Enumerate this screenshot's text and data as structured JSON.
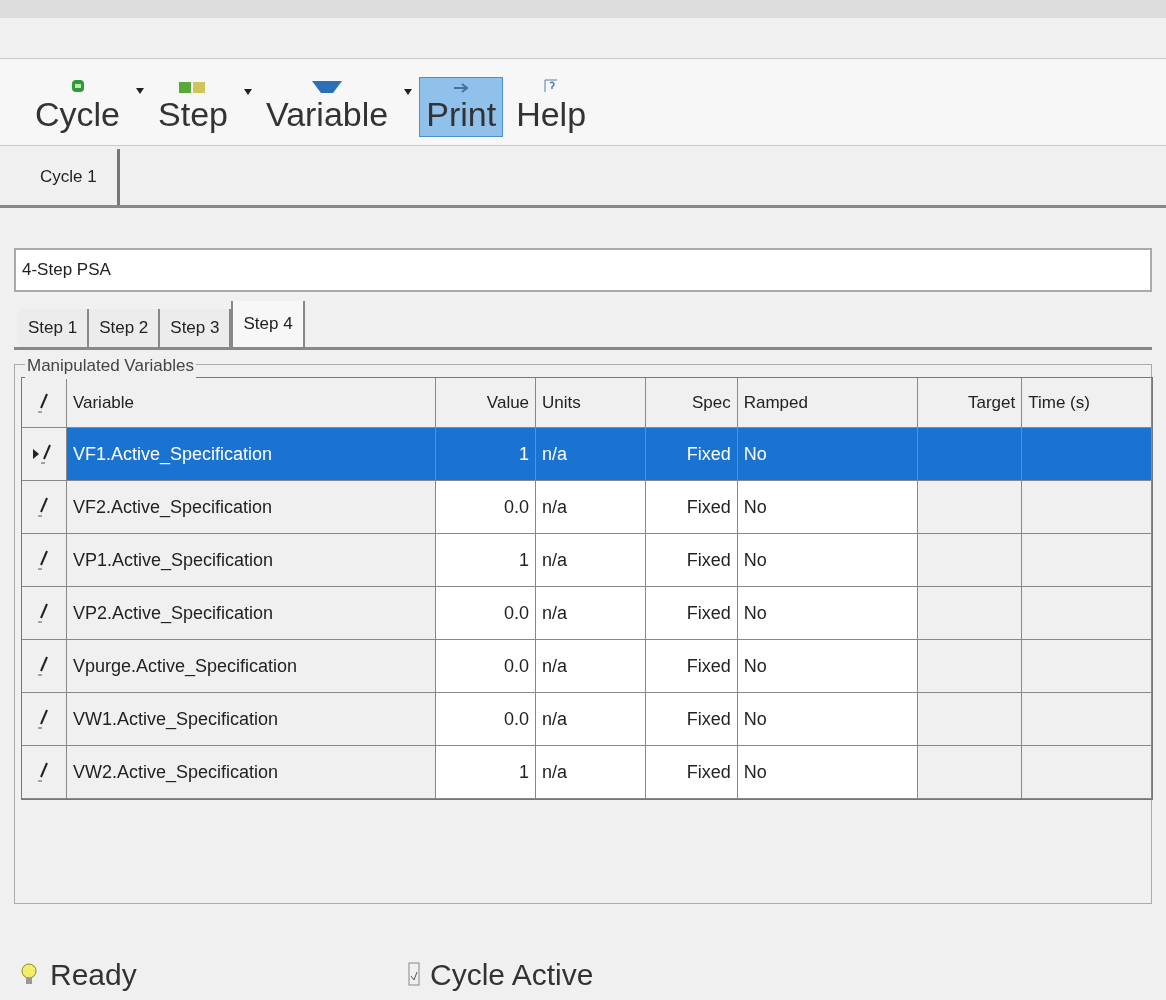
{
  "toolbar": [
    {
      "label": "Cycle",
      "kind": "cycle",
      "has_menu": true,
      "selected": false
    },
    {
      "label": "Step",
      "kind": "step",
      "has_menu": true,
      "selected": false
    },
    {
      "label": "Variable",
      "kind": "variable",
      "has_menu": true,
      "selected": false
    },
    {
      "label": "Print",
      "kind": "print",
      "has_menu": false,
      "selected": true
    },
    {
      "label": "Help",
      "kind": "help",
      "has_menu": false,
      "selected": false
    }
  ],
  "cycle_tabs": [
    {
      "label": "Cycle 1",
      "selected": true
    }
  ],
  "cycle_name": "4-Step PSA",
  "step_tabs": [
    {
      "label": "Step 1",
      "selected": false
    },
    {
      "label": "Step 2",
      "selected": false
    },
    {
      "label": "Step 3",
      "selected": false
    },
    {
      "label": "Step 4",
      "selected": true
    }
  ],
  "group_title": "Manipulated Variables",
  "table": {
    "columns": [
      "Variable",
      "Value",
      "Units",
      "Spec",
      "Ramped",
      "Target",
      "Time (s)"
    ],
    "rows": [
      {
        "cells": [
          "VF1.Active_Specification",
          "1",
          "n/a",
          "Fixed",
          "No"
        ],
        "selected": true
      },
      {
        "cells": [
          "VF2.Active_Specification",
          "0.0",
          "n/a",
          "Fixed",
          "No"
        ],
        "selected": false
      },
      {
        "cells": [
          "VP1.Active_Specification",
          "1",
          "n/a",
          "Fixed",
          "No"
        ],
        "selected": false
      },
      {
        "cells": [
          "VP2.Active_Specification",
          "0.0",
          "n/a",
          "Fixed",
          "No"
        ],
        "selected": false
      },
      {
        "cells": [
          "Vpurge.Active_Specification",
          "0.0",
          "n/a",
          "Fixed",
          "No"
        ],
        "selected": false
      },
      {
        "cells": [
          "VW1.Active_Specification",
          "0.0",
          "n/a",
          "Fixed",
          "No"
        ],
        "selected": false
      },
      {
        "cells": [
          "VW2.Active_Specification",
          "1",
          "n/a",
          "Fixed",
          "No"
        ],
        "selected": false
      }
    ]
  },
  "status_bar": [
    {
      "kind": "ready",
      "text": "Ready"
    },
    {
      "kind": "cycle",
      "text": "Cycle Active"
    }
  ]
}
